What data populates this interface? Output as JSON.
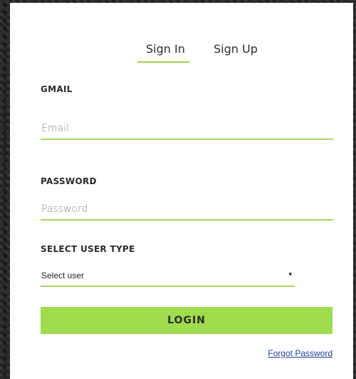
{
  "tabs": {
    "signin_label": "Sign In",
    "signup_label": "Sign Up",
    "active": "Sign In"
  },
  "form": {
    "email_label": "GMAIL",
    "email_placeholder": "Email",
    "email_value": "",
    "password_label": "PASSWORD",
    "password_placeholder": "Password",
    "password_value": "",
    "user_type_label": "SELECT USER TYPE",
    "user_type_selected": "Select user",
    "user_type_arrow": "▾",
    "login_label": "LOGIN",
    "forgot_label": "Forgot Password"
  },
  "colors": {
    "accent": "#9fdc4e",
    "underline": "#a6d56a",
    "link": "#1f3f9a",
    "background_texture": "#2b2b2b"
  }
}
